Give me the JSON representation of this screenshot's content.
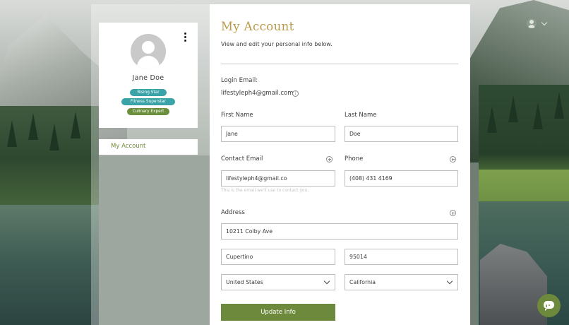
{
  "page": {
    "title": "My Account",
    "subtitle": "View and edit your personal info below."
  },
  "profile": {
    "name": "Jane Doe",
    "badges": [
      {
        "label": "Rising Star",
        "color": "#3aa3a8"
      },
      {
        "label": "Fitness Superstar",
        "color": "#3aa3a8"
      },
      {
        "label": "Culinary Expert",
        "color": "#6b8f3d"
      }
    ]
  },
  "sidebar": {
    "items": [
      {
        "label": "My Account",
        "active": true
      }
    ]
  },
  "form": {
    "login_email_label": "Login Email:",
    "login_email_value": "lifestyleph4@gmail.com",
    "first_name_label": "First Name",
    "first_name_value": "Jane",
    "last_name_label": "Last Name",
    "last_name_value": "Doe",
    "contact_email_label": "Contact Email",
    "contact_email_value": "lifestyleph4@gmail.co",
    "contact_email_hint": "This is the email we'll use to contact you.",
    "phone_label": "Phone",
    "phone_value": "(408) 431 4169",
    "address_label": "Address",
    "street_value": "10211 Colby Ave",
    "city_value": "Cupertino",
    "zip_value": "95014",
    "country_value": "United States",
    "state_value": "California",
    "submit_label": "Update Info"
  },
  "colors": {
    "accent": "#6d8a3c",
    "title": "#b89a4a",
    "badge_teal": "#3aa3a8"
  },
  "icons": {
    "more": "kebab-menu-icon",
    "info": "info-icon",
    "add": "plus-circle-icon",
    "chat": "chat-bubble-icon",
    "user": "user-avatar-icon"
  }
}
